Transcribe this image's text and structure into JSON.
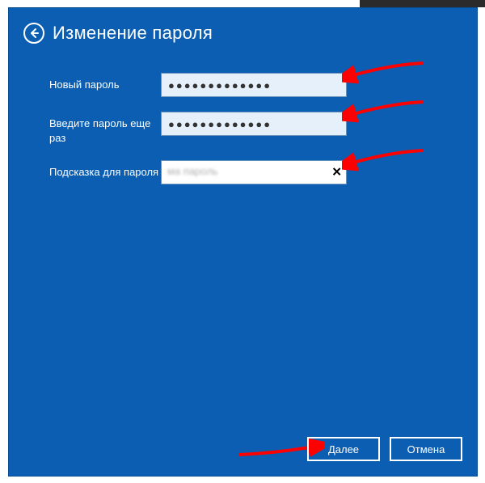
{
  "header": {
    "title": "Изменение пароля"
  },
  "fields": {
    "new_password": {
      "label": "Новый пароль",
      "value": "●●●●●●●●●●●●●"
    },
    "confirm_password": {
      "label": "Введите пароль еще раз",
      "value": "●●●●●●●●●●●●●"
    },
    "hint": {
      "label": "Подсказка для пароля",
      "value": ""
    }
  },
  "footer": {
    "next": "Далее",
    "cancel": "Отмена"
  },
  "colors": {
    "bg": "#0b5eb1",
    "input_bg": "#e6f0fb",
    "arrow": "#ff0000"
  }
}
